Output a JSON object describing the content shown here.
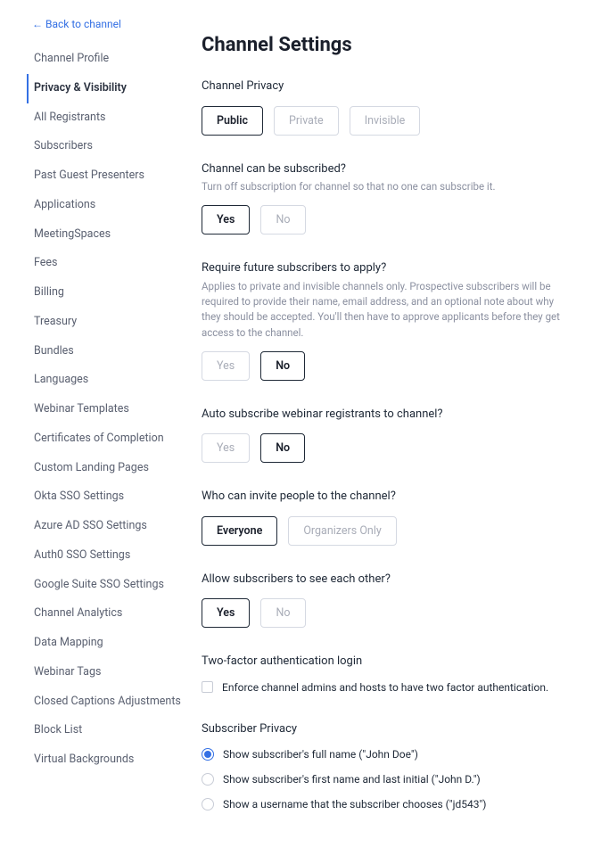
{
  "backLink": "← Back to channel",
  "sidebar": {
    "items": [
      {
        "label": "Channel Profile",
        "active": false
      },
      {
        "label": "Privacy & Visibility",
        "active": true
      },
      {
        "label": "All Registrants",
        "active": false
      },
      {
        "label": "Subscribers",
        "active": false
      },
      {
        "label": "Past Guest Presenters",
        "active": false
      },
      {
        "label": "Applications",
        "active": false
      },
      {
        "label": "MeetingSpaces",
        "active": false
      },
      {
        "label": "Fees",
        "active": false
      },
      {
        "label": "Billing",
        "active": false
      },
      {
        "label": "Treasury",
        "active": false
      },
      {
        "label": "Bundles",
        "active": false
      },
      {
        "label": "Languages",
        "active": false
      },
      {
        "label": "Webinar Templates",
        "active": false
      },
      {
        "label": "Certificates of Completion",
        "active": false
      },
      {
        "label": "Custom Landing Pages",
        "active": false
      },
      {
        "label": "Okta SSO Settings",
        "active": false
      },
      {
        "label": "Azure AD SSO Settings",
        "active": false
      },
      {
        "label": "Auth0 SSO Settings",
        "active": false
      },
      {
        "label": "Google Suite SSO Settings",
        "active": false
      },
      {
        "label": "Channel Analytics",
        "active": false
      },
      {
        "label": "Data Mapping",
        "active": false
      },
      {
        "label": "Webinar Tags",
        "active": false
      },
      {
        "label": "Closed Captions Adjustments",
        "active": false
      },
      {
        "label": "Block List",
        "active": false
      },
      {
        "label": "Virtual Backgrounds",
        "active": false
      }
    ]
  },
  "pageTitle": "Channel Settings",
  "sections": {
    "privacy": {
      "heading": "Channel Privacy",
      "options": [
        {
          "label": "Public",
          "selected": true
        },
        {
          "label": "Private",
          "selected": false
        },
        {
          "label": "Invisible",
          "selected": false
        }
      ]
    },
    "subscribe": {
      "heading": "Channel can be subscribed?",
      "desc": "Turn off subscription for channel so that no one can subscribe it.",
      "options": [
        {
          "label": "Yes",
          "selected": true
        },
        {
          "label": "No",
          "selected": false
        }
      ]
    },
    "apply": {
      "heading": "Require future subscribers to apply?",
      "desc": "Applies to private and invisible channels only. Prospective subscribers will be required to provide their name, email address, and an optional note about why they should be accepted. You'll then have to approve applicants before they get access to the channel.",
      "options": [
        {
          "label": "Yes",
          "selected": false
        },
        {
          "label": "No",
          "selected": true
        }
      ]
    },
    "autosub": {
      "heading": "Auto subscribe webinar registrants to channel?",
      "options": [
        {
          "label": "Yes",
          "selected": false
        },
        {
          "label": "No",
          "selected": true
        }
      ]
    },
    "invite": {
      "heading": "Who can invite people to the channel?",
      "options": [
        {
          "label": "Everyone",
          "selected": true
        },
        {
          "label": "Organizers Only",
          "selected": false
        }
      ]
    },
    "seeEach": {
      "heading": "Allow subscribers to see each other?",
      "options": [
        {
          "label": "Yes",
          "selected": true
        },
        {
          "label": "No",
          "selected": false
        }
      ]
    },
    "twofa": {
      "heading": "Two-factor authentication login",
      "checkboxLabel": "Enforce channel admins and hosts to have two factor authentication."
    },
    "subPrivacy": {
      "heading": "Subscriber Privacy",
      "radios": [
        {
          "label": "Show subscriber's full name (\"John Doe\")",
          "selected": true
        },
        {
          "label": "Show subscriber's first name and last initial (\"John D.\")",
          "selected": false
        },
        {
          "label": "Show a username that the subscriber chooses (\"jd543\")",
          "selected": false
        }
      ]
    }
  }
}
